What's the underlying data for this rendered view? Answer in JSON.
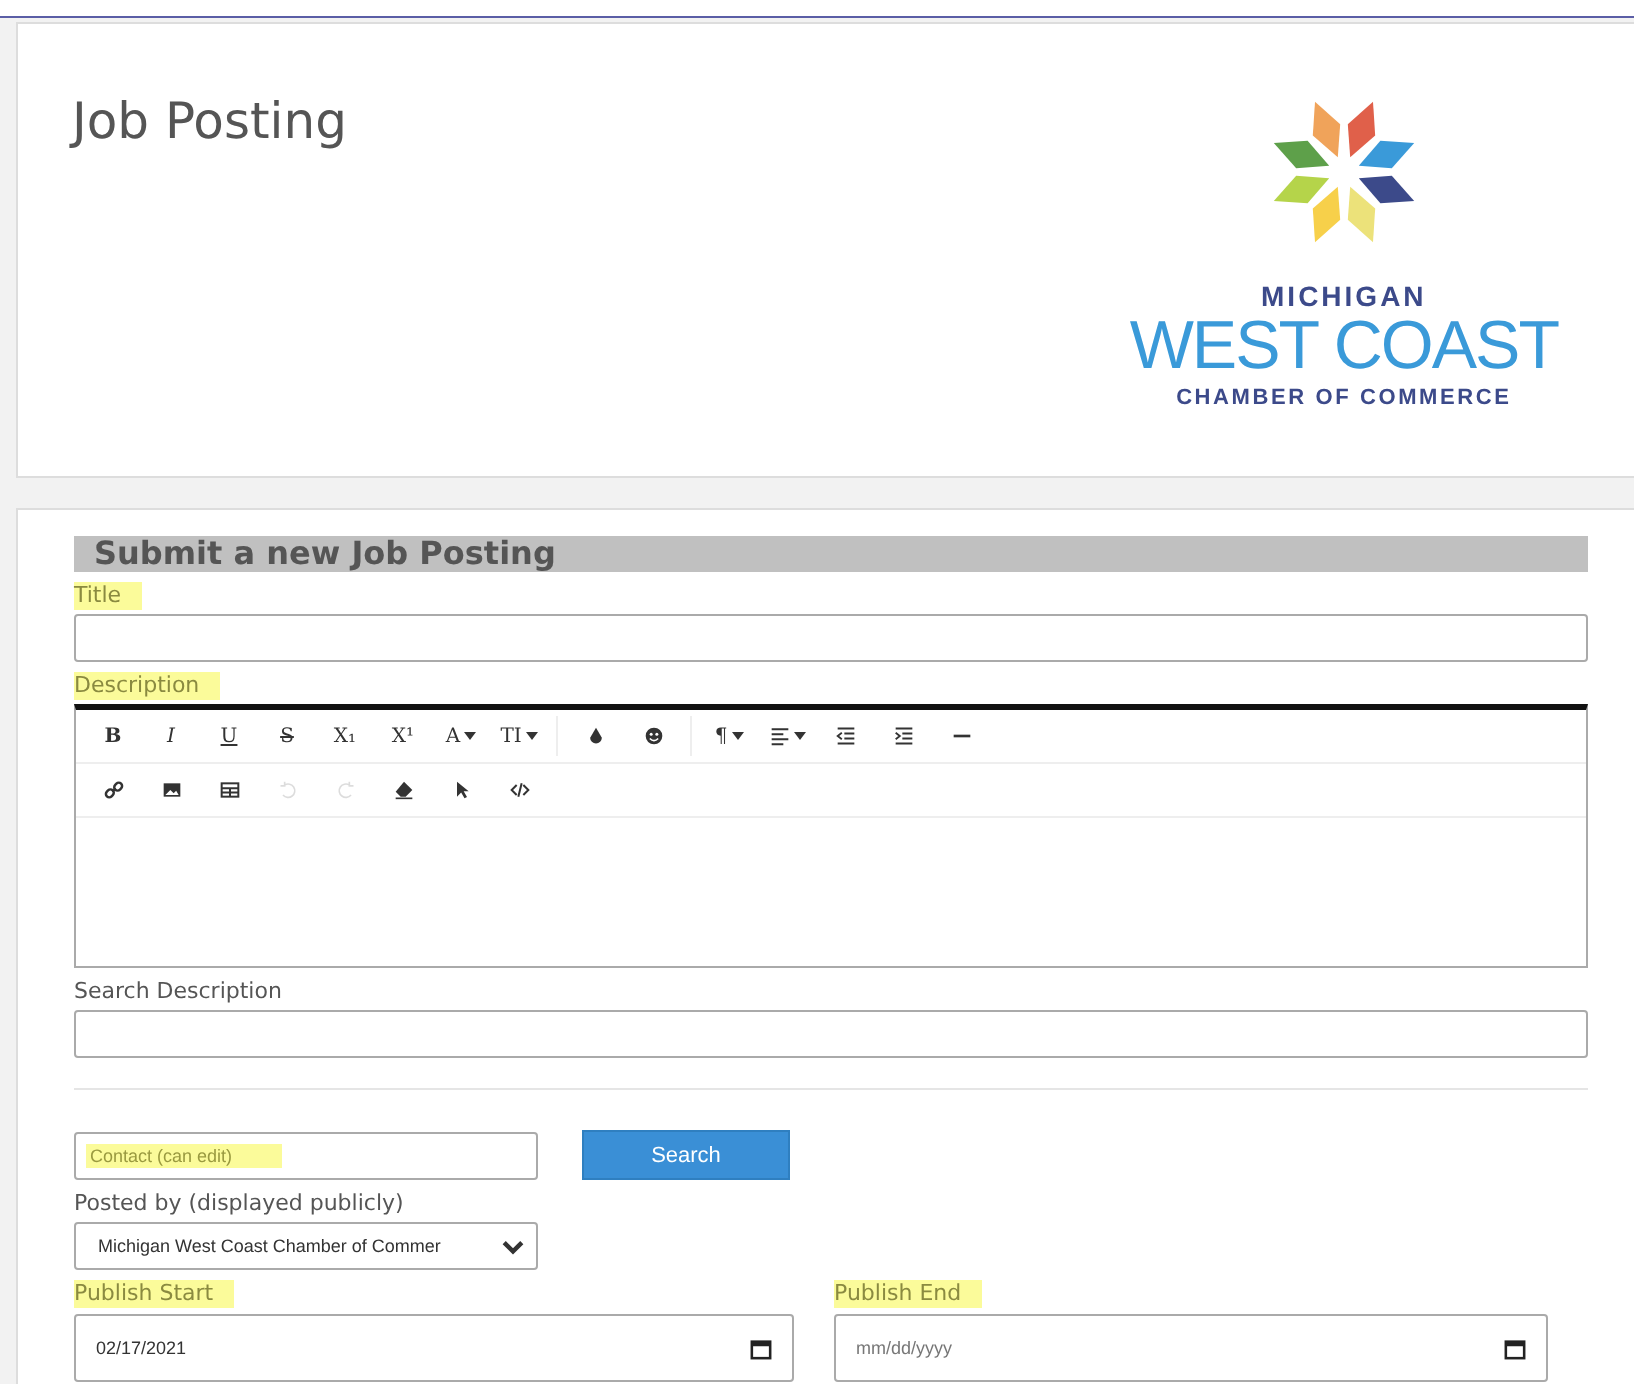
{
  "header": {
    "title": "Job Posting",
    "logo": {
      "line_1": "MICHIGAN",
      "line_2": "WEST COAST",
      "line_3": "CHAMBER OF COMMERCE"
    }
  },
  "form": {
    "heading": "Submit a new Job Posting",
    "title_field": {
      "label": "Title",
      "highlighted": true
    },
    "description": {
      "label": "Description",
      "highlighted": true,
      "toolbar_rows": [
        [
          [
            {
              "kind": "bold",
              "label": "B",
              "dropdown": false,
              "disabled": false
            },
            {
              "kind": "italic",
              "label": "I",
              "dropdown": false,
              "disabled": false
            },
            {
              "kind": "underline",
              "label": "U",
              "dropdown": false,
              "disabled": false
            },
            {
              "kind": "strike",
              "label": "S",
              "dropdown": false,
              "disabled": false
            },
            {
              "kind": "sub",
              "label": "X₁",
              "dropdown": false,
              "disabled": false
            },
            {
              "kind": "sup",
              "label": "X¹",
              "dropdown": false,
              "disabled": false
            },
            {
              "kind": "text",
              "label": "A",
              "dropdown": true,
              "disabled": false
            },
            {
              "kind": "text",
              "label": "TI",
              "dropdown": true,
              "disabled": false
            }
          ],
          [
            {
              "kind": "drop",
              "dropdown": false,
              "disabled": false
            },
            {
              "kind": "emoji",
              "dropdown": false,
              "disabled": false
            }
          ],
          [
            {
              "kind": "text",
              "label": "¶",
              "dropdown": true,
              "disabled": false
            },
            {
              "kind": "align",
              "dropdown": true,
              "disabled": false
            },
            {
              "kind": "outdent",
              "dropdown": false,
              "disabled": false
            },
            {
              "kind": "indent",
              "dropdown": false,
              "disabled": false
            },
            {
              "kind": "rule",
              "dropdown": false,
              "disabled": false
            }
          ]
        ],
        [
          [
            {
              "kind": "link",
              "dropdown": false,
              "disabled": false
            },
            {
              "kind": "image",
              "dropdown": false,
              "disabled": false
            },
            {
              "kind": "table",
              "dropdown": false,
              "disabled": false
            },
            {
              "kind": "undo",
              "dropdown": false,
              "disabled": true
            },
            {
              "kind": "redo",
              "dropdown": false,
              "disabled": true
            },
            {
              "kind": "eraser",
              "dropdown": false,
              "disabled": false
            },
            {
              "kind": "pointer",
              "dropdown": false,
              "disabled": false
            },
            {
              "kind": "code",
              "dropdown": false,
              "disabled": false
            }
          ]
        ]
      ]
    },
    "search_description": {
      "label": "Search Description",
      "highlighted": false
    },
    "contact": {
      "placeholder": "Contact (can edit)",
      "highlighted": true
    },
    "search_button": "Search",
    "posted_by": {
      "label": "Posted by (displayed publicly)",
      "highlighted": false,
      "value": "Michigan West Coast Chamber of Commer"
    },
    "publish_start": {
      "label": "Publish Start",
      "highlighted": true,
      "value": "02/17/2021"
    },
    "publish_end": {
      "label": "Publish End",
      "highlighted": true,
      "placeholder": "mm/dd/yyyy"
    }
  }
}
